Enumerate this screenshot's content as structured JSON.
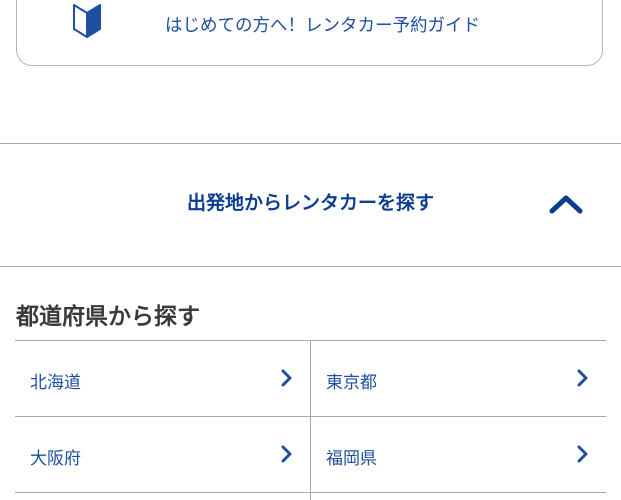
{
  "guide": {
    "label": "はじめての方へ！レンタカー予約ガイド",
    "icon": "beginner-mark-icon"
  },
  "accordion": {
    "title": "出発地からレンタカーを探す",
    "expanded": true,
    "icon": "chevron-up-icon"
  },
  "prefecture_section": {
    "heading": "都道府県から探す",
    "rows": [
      [
        {
          "name": "北海道",
          "icon": "chevron-right-icon"
        },
        {
          "name": "東京都",
          "icon": "chevron-right-icon"
        }
      ],
      [
        {
          "name": "大阪府",
          "icon": "chevron-right-icon"
        },
        {
          "name": "福岡県",
          "icon": "chevron-right-icon"
        }
      ]
    ]
  },
  "colors": {
    "link_blue": "#1f4fa0",
    "title_blue": "#0d3d8f",
    "divider": "#a9a9a9",
    "heading_text": "#3a3a3a"
  }
}
